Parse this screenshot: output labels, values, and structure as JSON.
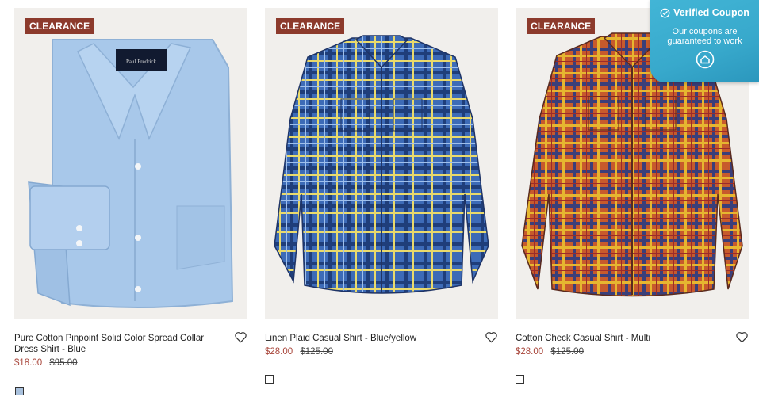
{
  "products": [
    {
      "badge": "CLEARANCE",
      "title": "Pure Cotton Pinpoint Solid Color Spread Collar Dress Shirt - Blue",
      "sale_price": "$18.00",
      "original_price": "$95.00",
      "shirt_colors": {
        "primary": "#a7c7e7",
        "secondary": "#8fb3d9"
      },
      "swatch_color": "#a9c1dd",
      "icon": "heart-icon"
    },
    {
      "badge": "CLEARANCE",
      "title": "Linen Plaid Casual Shirt - Blue/yellow",
      "sale_price": "$28.00",
      "original_price": "$125.00",
      "shirt_colors": {
        "primary": "#3f6cb8",
        "secondary": "#e8d86a"
      },
      "swatch_color": "#ffffff",
      "icon": "heart-icon"
    },
    {
      "badge": "CLEARANCE",
      "title": "Cotton Check Casual Shirt - Multi",
      "sale_price": "$28.00",
      "original_price": "$125.00",
      "shirt_colors": {
        "primary": "#c9572b",
        "secondary": "#e3b02f"
      },
      "swatch_color": "#ffffff",
      "icon": "heart-icon"
    }
  ],
  "coupon": {
    "title": "Verified Coupon",
    "subtitle": "Our coupons are guaranteed to work",
    "icon": "home-icon",
    "color": "#3aaed0"
  }
}
